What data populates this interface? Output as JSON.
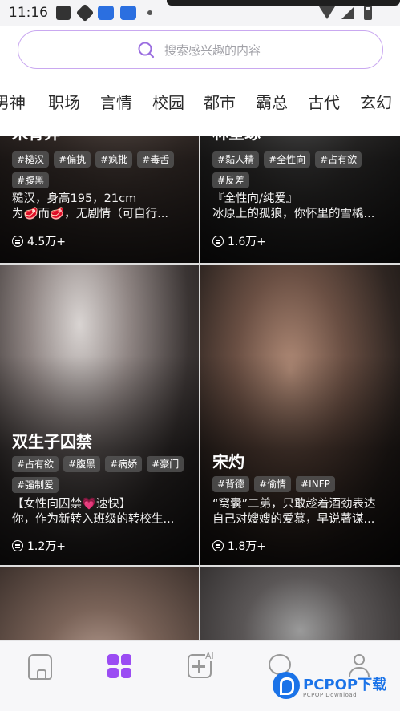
{
  "status_bar": {
    "time": "11:16"
  },
  "search": {
    "placeholder": "搜索感兴趣的内容"
  },
  "categories": [
    "男神",
    "职场",
    "言情",
    "校园",
    "都市",
    "霸总",
    "古代",
    "玄幻"
  ],
  "cards": [
    {
      "name": "宋青弈",
      "tags": [
        "#糙汉",
        "#偏执",
        "#疯批",
        "#毒舌",
        "#腹黑"
      ],
      "desc": [
        "糙汉，身高195，21cm",
        "为🥩而🥩，无剧情（可自行..."
      ],
      "count": "4.5万+"
    },
    {
      "name": "林星琢",
      "tags": [
        "#黏人精",
        "#全性向",
        "#占有欲",
        "#反差"
      ],
      "desc": [
        "『全性向/纯爱』",
        "冰原上的孤狼，你怀里的雪橇..."
      ],
      "count": "1.6万+"
    },
    {
      "name": "双生子囚禁",
      "tags": [
        "#占有欲",
        "#腹黑",
        "#病娇",
        "#豪门",
        "#强制爱"
      ],
      "desc": [
        "【女性向囚禁💗速快】",
        "你，作为新转入班级的转校生..."
      ],
      "count": "1.2万+"
    },
    {
      "name": "宋灼",
      "tags": [
        "#背德",
        "#偷情",
        "#INFP"
      ],
      "desc": [
        "“窝囊”二弟，只敢趁着酒劲表达",
        "自己对嫂嫂的爱慕，早说著谋..."
      ],
      "count": "1.8万+"
    }
  ],
  "watermark": {
    "brand": "PCPOP下载",
    "sub": "PCPOP Download"
  },
  "nav": {
    "create_badge": "AI"
  },
  "colors": {
    "accent": "#9b4cf3",
    "search_border": "#c9a8f0"
  }
}
